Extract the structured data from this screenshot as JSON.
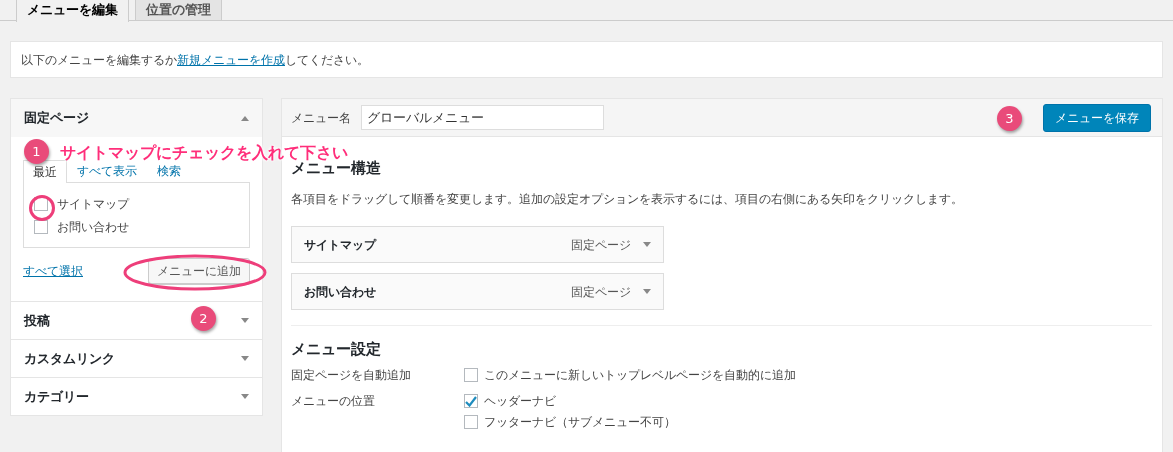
{
  "tabs": [
    {
      "label": "メニューを編集",
      "selected": true
    },
    {
      "label": "位置の管理",
      "selected": false
    }
  ],
  "notice": {
    "before": "以下のメニューを編集するか",
    "link": "新規メニューを作成",
    "after": "してください。"
  },
  "sidebar": {
    "sections": [
      {
        "title": "固定ページ",
        "expanded": true,
        "tabs": [
          {
            "label": "最近",
            "selected": true
          },
          {
            "label": "すべて表示",
            "selected": false
          },
          {
            "label": "検索",
            "selected": false
          }
        ],
        "items": [
          {
            "label": "サイトマップ",
            "checked": false
          },
          {
            "label": "お問い合わせ",
            "checked": false
          }
        ],
        "select_all": "すべて選択",
        "add_button": "メニューに追加"
      },
      {
        "title": "投稿",
        "expanded": false
      },
      {
        "title": "カスタムリンク",
        "expanded": false
      },
      {
        "title": "カテゴリー",
        "expanded": false
      }
    ]
  },
  "annotations": [
    {
      "number": "1",
      "text": "サイトマップにチェックを入れて下さい"
    },
    {
      "number": "2"
    },
    {
      "number": "3"
    }
  ],
  "menu_name": {
    "label": "メニュー名",
    "value": "グローバルメニュー"
  },
  "save_button": "メニューを保存",
  "structure": {
    "heading": "メニュー構造",
    "description": "各項目をドラッグして順番を変更します。追加の設定オプションを表示するには、項目の右側にある矢印をクリックします。",
    "items": [
      {
        "label": "サイトマップ",
        "type": "固定ページ"
      },
      {
        "label": "お問い合わせ",
        "type": "固定ページ"
      }
    ]
  },
  "settings": {
    "heading": "メニュー設定",
    "rows": [
      {
        "label": "固定ページを自動追加",
        "options": [
          {
            "label": "このメニューに新しいトップレベルページを自動的に追加",
            "checked": false
          }
        ]
      },
      {
        "label": "メニューの位置",
        "options": [
          {
            "label": "ヘッダーナビ",
            "checked": true
          },
          {
            "label": "フッターナビ（サブメニュー不可）",
            "checked": false
          }
        ]
      }
    ]
  }
}
